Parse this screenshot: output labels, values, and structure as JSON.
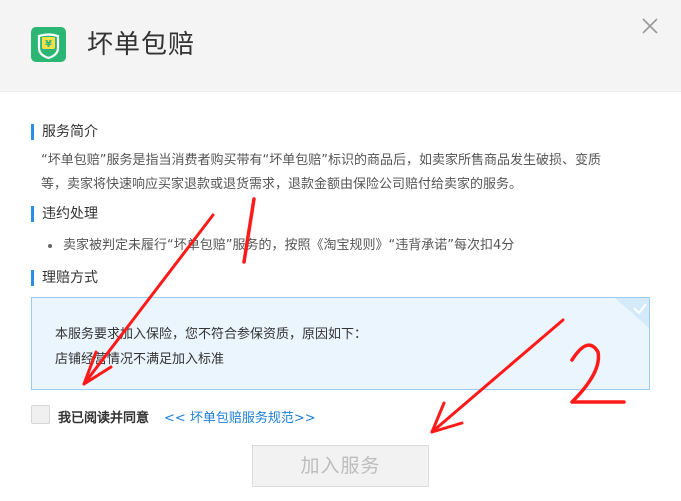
{
  "header": {
    "title": "坏单包赔",
    "logo_icon": "shield-yen-icon",
    "close_icon": "close-icon"
  },
  "sections": {
    "intro": {
      "title": "服务简介",
      "line1": "“坏单包赔”服务是指当消费者购买带有“坏单包赔”标识的商品后，如卖家所售商品发生破损、变质",
      "line2": "等，卖家将快速响应买家退款或退货需求，退款金额由保险公司赔付给卖家的服务。"
    },
    "violation": {
      "title": "违约处理",
      "bullet": "卖家被判定未履行“坏单包赔”服务的，按照《淘宝规则》“违背承诺”每次扣4分"
    },
    "claim": {
      "title": "理赔方式"
    }
  },
  "notice": {
    "line1": "本服务要求加入保险，您不符合参保资质，原因如下：",
    "line2": "店铺经营情况不满足加入标准"
  },
  "agreement": {
    "label": "我已阅读并同意",
    "link": "<< 坏单包赔服务规范>>",
    "checked": false
  },
  "join_button": {
    "label": "加入服务",
    "enabled": false
  },
  "annotations": {
    "mark1": "1",
    "mark2": "2"
  },
  "colors": {
    "accent": "#2a8fe6",
    "logo_bg": "#2bb673",
    "link": "#1e7fd8",
    "notice_bg": "#eaf5fd",
    "annotation": "#ff1a1a"
  }
}
